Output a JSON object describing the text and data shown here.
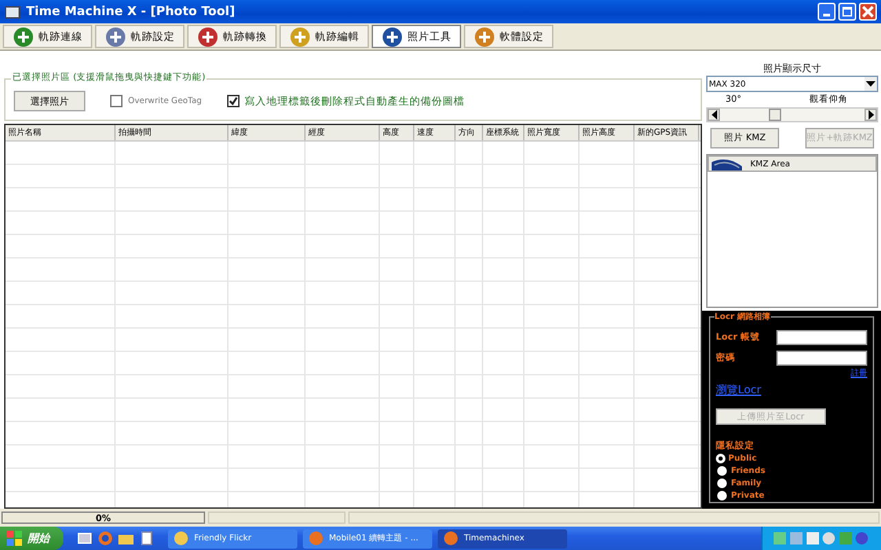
{
  "window": {
    "title": "Time Machine X - [Photo Tool]"
  },
  "tabs": [
    {
      "label": "軌跡連線",
      "selected": false
    },
    {
      "label": "軌跡設定",
      "selected": false
    },
    {
      "label": "軌跡轉換",
      "selected": false
    },
    {
      "label": "軌跡編輯",
      "selected": false
    },
    {
      "label": "照片工具",
      "selected": true
    },
    {
      "label": "軟體設定",
      "selected": false
    }
  ],
  "photo_group": {
    "title": "已選擇照片區 (支援滑鼠拖曳與快捷鍵下功能)",
    "select_button": "選擇照片",
    "options": [
      {
        "label": "Overwrite GeoTag",
        "checked": false
      },
      {
        "label": "寫入地理標籤後刪除程式自動產生的備份圖檔",
        "checked": true
      }
    ]
  },
  "table": {
    "columns": [
      "照片名稱",
      "拍攝時間",
      "緯度",
      "經度",
      "高度",
      "速度",
      "方向",
      "座標系統",
      "照片寬度",
      "照片高度",
      "新的GPS資訊"
    ]
  },
  "side": {
    "size_label": "照片顯示尺寸",
    "size_value": "MAX 320",
    "angle_value": "30°",
    "angle_label": "觀看仰角",
    "angle_slider": {
      "level": 0.38
    },
    "buttons": [
      {
        "label": "照片 KMZ",
        "disabled": false
      },
      {
        "label": "照片+軌跡KMZ",
        "disabled": true
      }
    ],
    "list_items": [
      "KMZ Area"
    ]
  },
  "locr": {
    "title": "Locr 網路相簿",
    "account_label": "Locr 帳號",
    "password_label": "密碼",
    "register_link": "註冊",
    "browse_link": "瀏覽Locr",
    "upload_button": "上傳照片至Locr",
    "privacy_label": "隱私設定",
    "privacy": [
      {
        "label": "Public",
        "selected": true
      },
      {
        "label": "Friends",
        "selected": false
      },
      {
        "label": "Family",
        "selected": false
      },
      {
        "label": "Private",
        "selected": false
      }
    ]
  },
  "status_bar": {
    "progress": "0%"
  },
  "taskbar": {
    "start": "開始",
    "tasks": [
      {
        "label": "Friendly Flickr",
        "selected": false
      },
      {
        "label": "Mobile01 續轉主題 - ...",
        "selected": false
      },
      {
        "label": "Timemachinex",
        "selected": true
      }
    ]
  }
}
